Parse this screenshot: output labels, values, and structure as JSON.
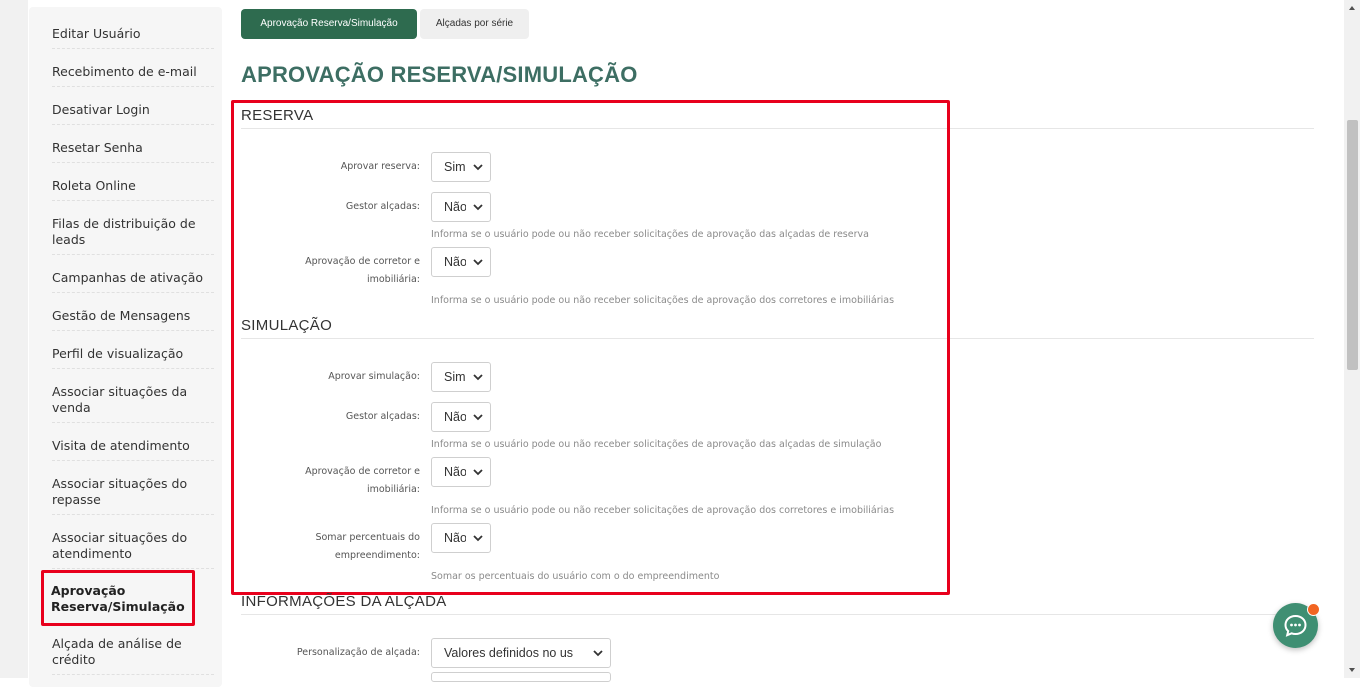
{
  "sidebar": {
    "items": [
      {
        "label": "Editar Usuário"
      },
      {
        "label": "Recebimento de e-mail"
      },
      {
        "label": "Desativar Login"
      },
      {
        "label": "Resetar Senha"
      },
      {
        "label": "Roleta Online"
      },
      {
        "label": "Filas de distribuição de leads"
      },
      {
        "label": "Campanhas de ativação"
      },
      {
        "label": "Gestão de Mensagens"
      },
      {
        "label": "Perfil de visualização"
      },
      {
        "label": "Associar situações da venda"
      },
      {
        "label": "Visita de atendimento"
      },
      {
        "label": "Associar situações do repasse"
      },
      {
        "label": "Associar situações do atendimento"
      },
      {
        "label": "Aprovação Reserva/Simulação"
      },
      {
        "label": "Alçada de análise de crédito"
      }
    ]
  },
  "tabs": {
    "active": "Aprovação Reserva/Simulação",
    "inactive": "Alçadas por série"
  },
  "page_title": "APROVAÇÃO RESERVA/SIMULAÇÃO",
  "reserva": {
    "title": "RESERVA",
    "aprovar_label": "Aprovar reserva:",
    "aprovar_value": "Sim",
    "gestor_label": "Gestor alçadas:",
    "gestor_value": "Não",
    "gestor_help": "Informa se o usuário pode ou não receber solicitações de aprovação das alçadas de reserva",
    "corretor_label_1": "Aprovação de corretor e",
    "corretor_label_2": "imobiliária:",
    "corretor_value": "Não",
    "corretor_help": "Informa se o usuário pode ou não receber solicitações de aprovação dos corretores e imobiliárias"
  },
  "simulacao": {
    "title": "SIMULAÇÃO",
    "aprovar_label": "Aprovar simulação:",
    "aprovar_value": "Sim",
    "gestor_label": "Gestor alçadas:",
    "gestor_value": "Não",
    "gestor_help": "Informa se o usuário pode ou não receber solicitações de aprovação das alçadas de simulação",
    "corretor_label_1": "Aprovação de corretor e",
    "corretor_label_2": "imobiliária:",
    "corretor_value": "Não",
    "corretor_help": "Informa se o usuário pode ou não receber solicitações de aprovação dos corretores e imobiliárias",
    "somar_label_1": "Somar percentuais do",
    "somar_label_2": "empreendimento:",
    "somar_value": "Não",
    "somar_help": "Somar os percentuais do usuário com o do empreendimento"
  },
  "alcada": {
    "title": "INFORMAÇÕES DA ALÇADA",
    "personalizacao_label": "Personalização de alçada:",
    "personalizacao_value": "Valores definidos no us"
  },
  "icons": {
    "chevron": "chevron-down-icon",
    "chat": "chat-bubble-icon"
  },
  "colors": {
    "accent_green": "#2e6b4f",
    "title_teal": "#3d6e63",
    "highlight_red": "#e8001c",
    "chat_green": "#3f8f73",
    "notification_orange": "#f26522"
  }
}
